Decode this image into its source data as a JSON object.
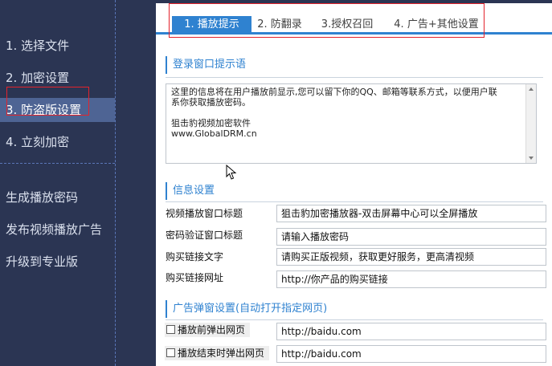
{
  "sidebar": {
    "steps": [
      "1. 选择文件",
      "2. 加密设置",
      "3. 防盗版设置",
      "4. 立刻加密"
    ],
    "active_step": 2,
    "tools": [
      "生成播放密码",
      "发布视频播放广告",
      "升级到专业版"
    ]
  },
  "tabs": [
    {
      "label": "1. 播放提示",
      "active": true
    },
    {
      "label": "2. 防翻录",
      "active": false
    },
    {
      "label": "3.授权召回",
      "active": false
    },
    {
      "label": "4. 广告+其他设置",
      "active": false
    }
  ],
  "login_prompt": {
    "title": "登录窗口提示语",
    "lines": [
      "这里的信息将在用户播放前显示,您可以留下你的QQ、邮箱等联系方式，以便用户联",
      "系你获取播放密码。",
      "",
      "狙击豹视频加密软件",
      "www.GlobalDRM.cn"
    ]
  },
  "info": {
    "title": "信息设置",
    "fields": [
      {
        "label": "视频播放窗口标题",
        "value": "狙击豹加密播放器-双击屏幕中心可以全屏播放"
      },
      {
        "label": "密码验证窗口标题",
        "value": "请输入播放密码"
      },
      {
        "label": "购买链接文字",
        "value": "请购买正版视频，获取更好服务，更高清视频"
      },
      {
        "label": "购买链接网址",
        "value": "http://你产品的购买链接"
      }
    ]
  },
  "ad_popup": {
    "title": "广告弹窗设置(自动打开指定网页)",
    "options": [
      {
        "label": "播放前弹出网页",
        "checked": false,
        "url": "http://baidu.com"
      },
      {
        "label": "播放结束时弹出网页",
        "checked": false,
        "url": "http://baidu.com"
      }
    ]
  },
  "colors": {
    "accent": "#2f82d0",
    "sidebar_bg": "#2b3553",
    "sidebar_active": "#4e6494",
    "highlight": "#e3232c"
  }
}
